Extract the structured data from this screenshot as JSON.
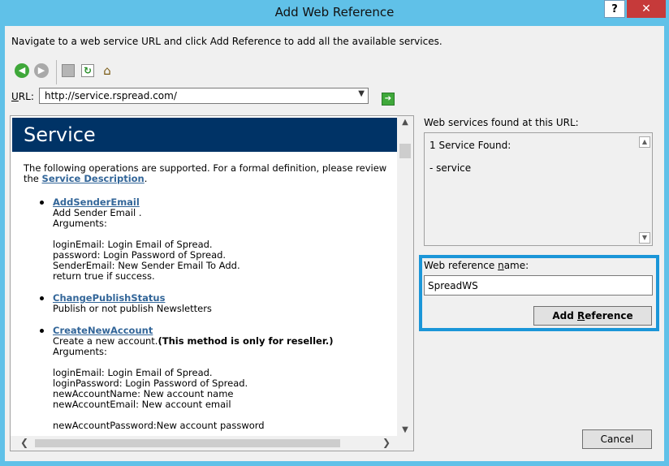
{
  "window": {
    "title": "Add Web Reference",
    "help_label": "?",
    "close_label": "✕"
  },
  "instructions": "Navigate to a web service URL and click Add Reference to add all the available services.",
  "toolbar": {
    "back_icon": "back-arrow-icon",
    "forward_icon": "forward-arrow-icon",
    "stop_icon": "stop-icon",
    "refresh_icon": "refresh-icon",
    "home_icon": "home-icon"
  },
  "url": {
    "label_u": "U",
    "label_rest": "RL:",
    "value": "http://service.rspread.com/",
    "go_icon": "go-arrow-icon"
  },
  "browser": {
    "header": "Service",
    "intro_text": "The following operations are supported. For a formal definition, please review the ",
    "intro_link": "Service Description",
    "intro_end": ".",
    "operations": [
      {
        "name": "AddSenderEmail",
        "lines": [
          "Add Sender Email .",
          "Arguments:",
          "",
          "loginEmail: Login Email of Spread.",
          "password: Login Password of Spread.",
          "SenderEmail: New Sender Email To Add.",
          "return true if success."
        ]
      },
      {
        "name": "ChangePublishStatus",
        "lines": [
          "Publish or not publish Newsletters"
        ]
      },
      {
        "name": "CreateNewAccount",
        "line1_plain": "Create a new account.",
        "line1_bold": "(This method is only for reseller.)",
        "lines": [
          "Arguments:",
          "",
          "loginEmail: Login Email of Spread.",
          "loginPassword: Login Password of Spread.",
          "newAccountName: New account name",
          "newAccountEmail: New account email",
          "",
          "newAccountPassword:New account password"
        ]
      }
    ]
  },
  "found": {
    "label": "Web services found at this URL:",
    "count_text": "1 Service Found:",
    "item": "- service"
  },
  "reference": {
    "label_pre": "Web reference ",
    "label_u": "n",
    "label_post": "ame:",
    "value": "SpreadWS"
  },
  "buttons": {
    "add_pre": "Add ",
    "add_u": "R",
    "add_post": "eference",
    "cancel": "Cancel"
  },
  "colors": {
    "frame": "#60c1e8",
    "service_header": "#003366",
    "link": "#336699",
    "highlight": "#1b96d8",
    "close": "#c63a3a"
  }
}
